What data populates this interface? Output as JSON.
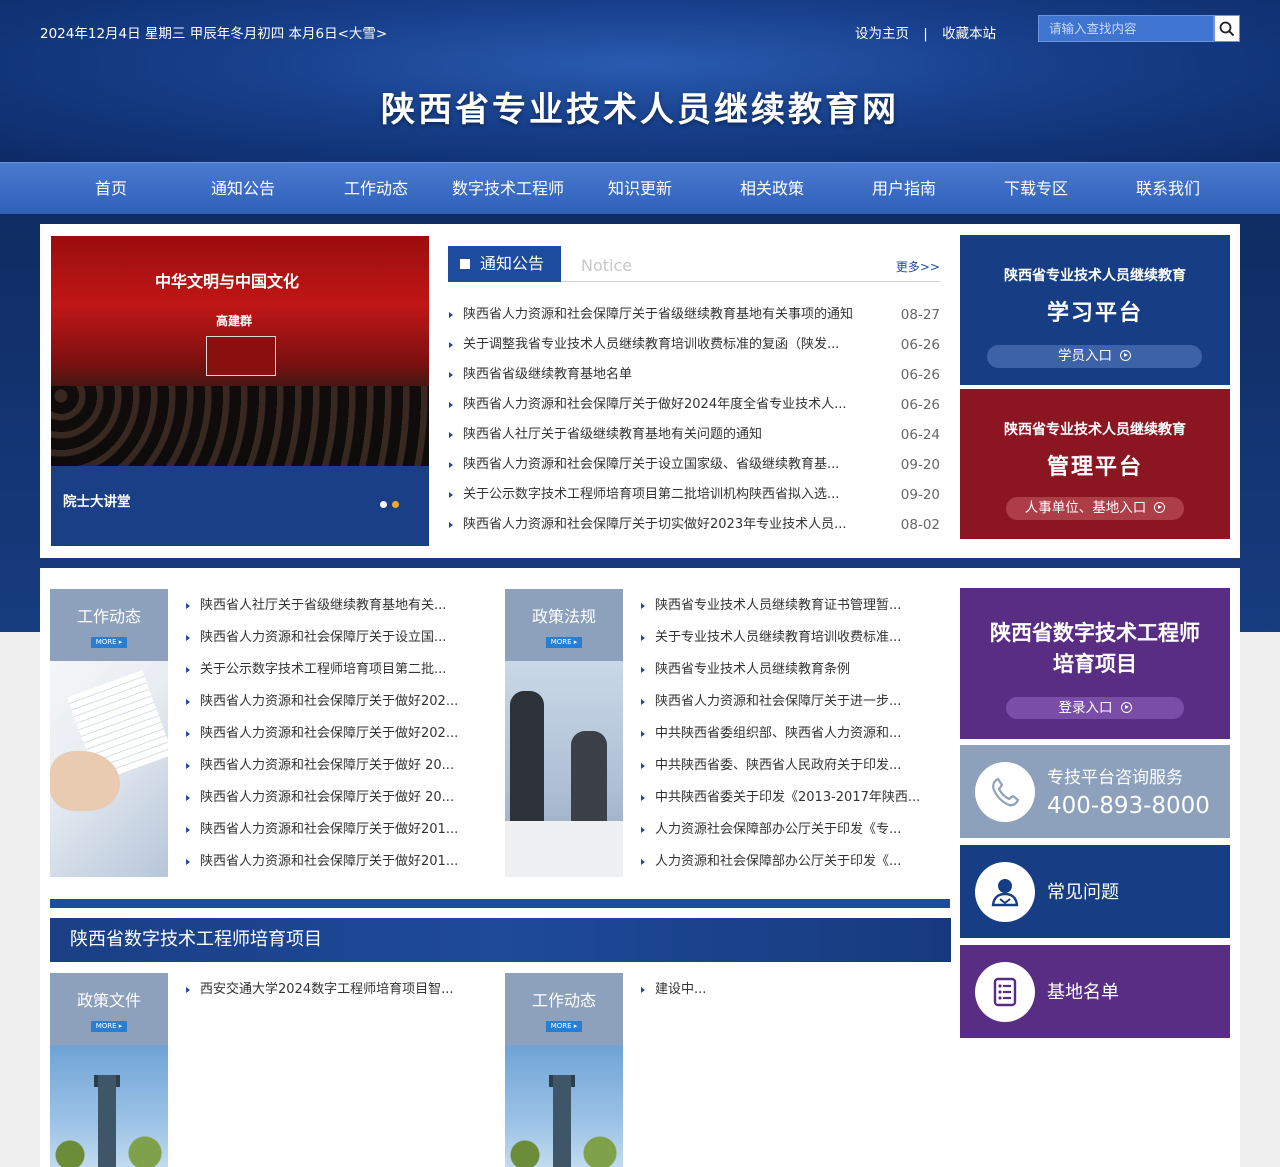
{
  "topbar": {
    "date": "2024年12月4日  星期三  甲辰年冬月初四  本月6日<大雪>",
    "set_home": "设为主页",
    "separator": "|",
    "bookmark": "收藏本站",
    "search_placeholder": "请输入查找内容"
  },
  "site_title": "陕西省专业技术人员继续教育网",
  "nav": [
    "首页",
    "通知公告",
    "工作动态",
    "数字技术工程师",
    "知识更新",
    "相关政策",
    "用户指南",
    "下载专区",
    "联系我们"
  ],
  "slider": {
    "image_title": "中华文明与中国文化",
    "image_speaker": "高建群",
    "caption": "院士大讲堂",
    "slide_count": 2,
    "active_slide": 2
  },
  "notice": {
    "tab_label": "通知公告",
    "tab_en": "Notice",
    "more": "更多>>",
    "items": [
      {
        "title": "陕西省人力资源和社会保障厅关于省级继续教育基地有关事项的通知",
        "date": "08-27"
      },
      {
        "title": "关于调整我省专业技术人员继续教育培训收费标准的复函（陕发...",
        "date": "06-26"
      },
      {
        "title": "陕西省省级继续教育基地名单",
        "date": "06-26"
      },
      {
        "title": "陕西省人力资源和社会保障厅关于做好2024年度全省专业技术人...",
        "date": "06-26"
      },
      {
        "title": "陕西省人社厅关于省级继续教育基地有关问题的通知",
        "date": "06-24"
      },
      {
        "title": "陕西省人力资源和社会保障厅关于设立国家级、省级继续教育基...",
        "date": "09-20"
      },
      {
        "title": "关于公示数字技术工程师培育项目第二批培训机构陕西省拟入选...",
        "date": "09-20"
      },
      {
        "title": "陕西省人力资源和社会保障厅关于切实做好2023年专业技术人员...",
        "date": "08-02"
      }
    ]
  },
  "platforms": {
    "study": {
      "subtitle": "陕西省专业技术人员继续教育",
      "title": "学习平台",
      "button": "学员入口"
    },
    "manage": {
      "subtitle": "陕西省专业技术人员继续教育",
      "title": "管理平台",
      "button": "人事单位、基地入口"
    }
  },
  "more_label": "MORE ▸",
  "work_news": {
    "label": "工作动态",
    "items": [
      "陕西省人社厅关于省级继续教育基地有关...",
      "陕西省人力资源和社会保障厅关于设立国...",
      "关于公示数字技术工程师培育项目第二批...",
      "陕西省人力资源和社会保障厅关于做好202...",
      "陕西省人力资源和社会保障厅关于做好202...",
      "陕西省人力资源和社会保障厅关于做好 20...",
      "陕西省人力资源和社会保障厅关于做好 20...",
      "陕西省人力资源和社会保障厅关于做好201...",
      "陕西省人力资源和社会保障厅关于做好201..."
    ]
  },
  "policy": {
    "label": "政策法规",
    "items": [
      "陕西省专业技术人员继续教育证书管理暂...",
      "关于专业技术人员继续教育培训收费标准...",
      "陕西省专业技术人员继续教育条例",
      "陕西省人力资源和社会保障厅关于进一步...",
      "中共陕西省委组织部、陕西省人力资源和...",
      "中共陕西省委、陕西省人民政府关于印发...",
      "中共陕西省委关于印发《2013-2017年陕西...",
      "人力资源社会保障部办公厅关于印发《专...",
      "人力资源和社会保障部办公厅关于印发《..."
    ]
  },
  "digital_section": {
    "header": "陕西省数字技术工程师培育项目",
    "policy_files": {
      "label": "政策文件",
      "items": [
        "西安交通大学2024数字工程师培育项目智..."
      ]
    },
    "work": {
      "label": "工作动态",
      "items": [
        "建设中..."
      ]
    }
  },
  "right_panel": {
    "digital": {
      "title_line1": "陕西省数字技术工程师",
      "title_line2": "培育项目",
      "button": "登录入口"
    },
    "hotline": {
      "label": "专技平台咨询服务",
      "number": "400-893-8000"
    },
    "faq": {
      "label": "常见问题"
    },
    "bases": {
      "label": "基地名单"
    }
  },
  "colors": {
    "primary_blue": "#1d4b9e",
    "dark_blue": "#173e85",
    "red": "#8b1622",
    "purple": "#5a2d85",
    "grey_blue": "#8da1bd"
  }
}
